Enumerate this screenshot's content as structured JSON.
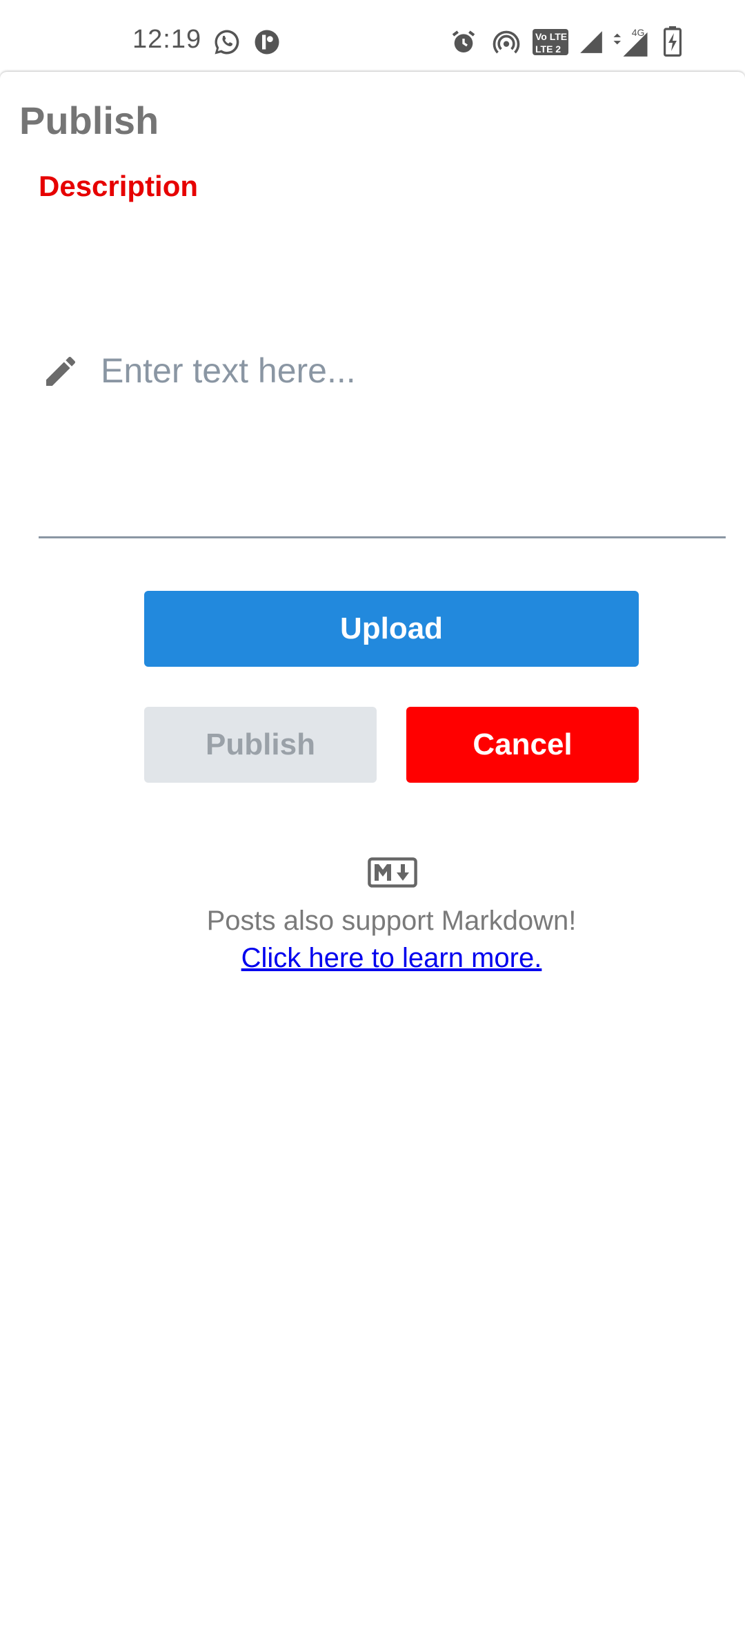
{
  "status_bar": {
    "time": "12:19",
    "left_icons": [
      "whatsapp-icon",
      "app-notification-icon"
    ],
    "right_icons": [
      "alarm-icon",
      "hotspot-icon",
      "volte-lte-icon",
      "signal-icon",
      "signal-4g-icon",
      "battery-charging-icon"
    ],
    "network_label": "4G"
  },
  "page": {
    "title": "Publish"
  },
  "description": {
    "label": "Description",
    "placeholder": "Enter text here...",
    "icon": "pencil-icon"
  },
  "actions": {
    "upload_label": "Upload",
    "publish_label": "Publish",
    "cancel_label": "Cancel"
  },
  "markdown": {
    "icon": "markdown-icon",
    "note": "Posts also support Markdown!",
    "link_text": "Click here to learn more."
  },
  "colors": {
    "label_red": "#e60000",
    "upload_blue": "#2289dd",
    "cancel_red": "#ff0000",
    "disabled_gray": "#e1e5e9",
    "link_blue": "#0000ee"
  }
}
